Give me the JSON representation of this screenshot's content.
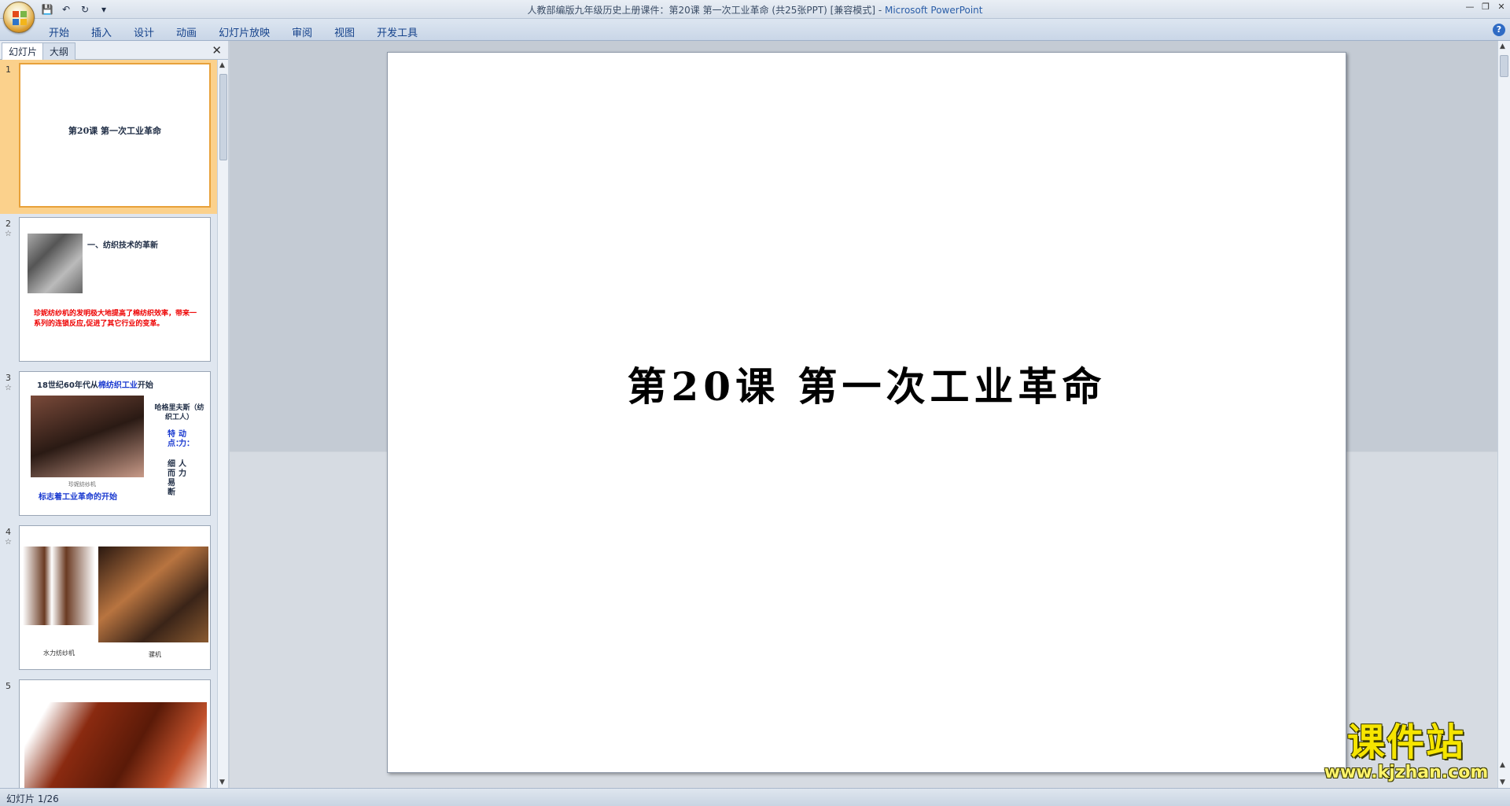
{
  "window": {
    "title_doc": "人教部编版九年级历史上册课件：第20课   第一次工业革命 (共25张PPT) [兼容模式]",
    "title_sep": " - ",
    "title_app": "Microsoft PowerPoint",
    "controls": [
      "—",
      "❐",
      "✕"
    ]
  },
  "qat": {
    "save": "💾",
    "undo": "↶",
    "redo": "↻",
    "more": "▾"
  },
  "ribbon": {
    "tabs": [
      "开始",
      "插入",
      "设计",
      "动画",
      "幻灯片放映",
      "审阅",
      "视图",
      "开发工具"
    ],
    "help": "?"
  },
  "left_pane": {
    "tab_slides": "幻灯片",
    "tab_outline": "大纲",
    "close": "✕",
    "thumbnails": [
      {
        "num": "1",
        "star": "",
        "title": "第20课  第一次工业革命"
      },
      {
        "num": "2",
        "star": "☆",
        "heading": "一、纺织技术的革新",
        "body": "珍妮纺纱机的发明极大地提高了棉纺织效率，带来一系列的连锁反应,促进了其它行业的变革。"
      },
      {
        "num": "3",
        "star": "☆",
        "head_pre": "18世纪60年代从",
        "head_blue": "棉纺织工业",
        "head_post": "开始",
        "person": "哈格里夫斯（纺织工人）",
        "v1": "特点：",
        "v2": "动力：",
        "v3": "细而易断",
        "v4": "人力",
        "caption": "珍妮纺纱机",
        "footer": "标志着工业革命的开始"
      },
      {
        "num": "4",
        "star": "☆",
        "cap1": "水力纺纱机",
        "cap2": "骡机"
      },
      {
        "num": "5",
        "star": ""
      }
    ]
  },
  "slide": {
    "title": "第20课  第一次工业革命"
  },
  "status": {
    "text": "幻灯片 1/26"
  },
  "watermark": {
    "big": "课件站",
    "small": "www.kjzhan.com"
  }
}
